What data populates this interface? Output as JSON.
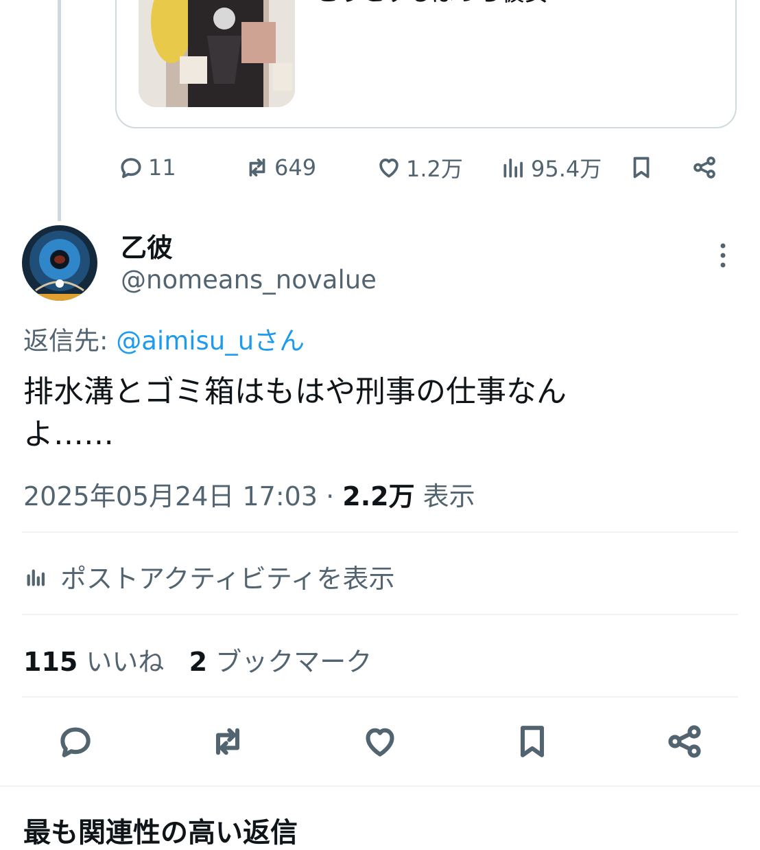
{
  "quoted_post": {
    "text": "こうとするぼっち彼女",
    "actions": {
      "replies": "11",
      "reposts": "649",
      "likes": "1.2万",
      "views": "95.4万"
    }
  },
  "main_post": {
    "display_name": "乙彼",
    "handle": "@nomeans_novalue",
    "reply_prefix": "返信先: ",
    "reply_mention": "@aimisu_uさん",
    "text_line1": "排水溝とゴミ箱はもはや刑事の仕事なん",
    "text_line2": "よ……",
    "timestamp": "2025年05月24日 17:03",
    "separator": " · ",
    "view_count": "2.2万",
    "view_label": " 表示",
    "activity_label": "ポストアクティビティを表示",
    "likes_count": "115",
    "likes_label": " いいね",
    "bookmarks_count": "2",
    "bookmarks_label": " ブックマーク"
  },
  "section": {
    "heading": "最も関連性の高い返信"
  },
  "colors": {
    "accent": "#1d9bf0",
    "secondary_text": "#536471",
    "border": "#cfd9de"
  }
}
